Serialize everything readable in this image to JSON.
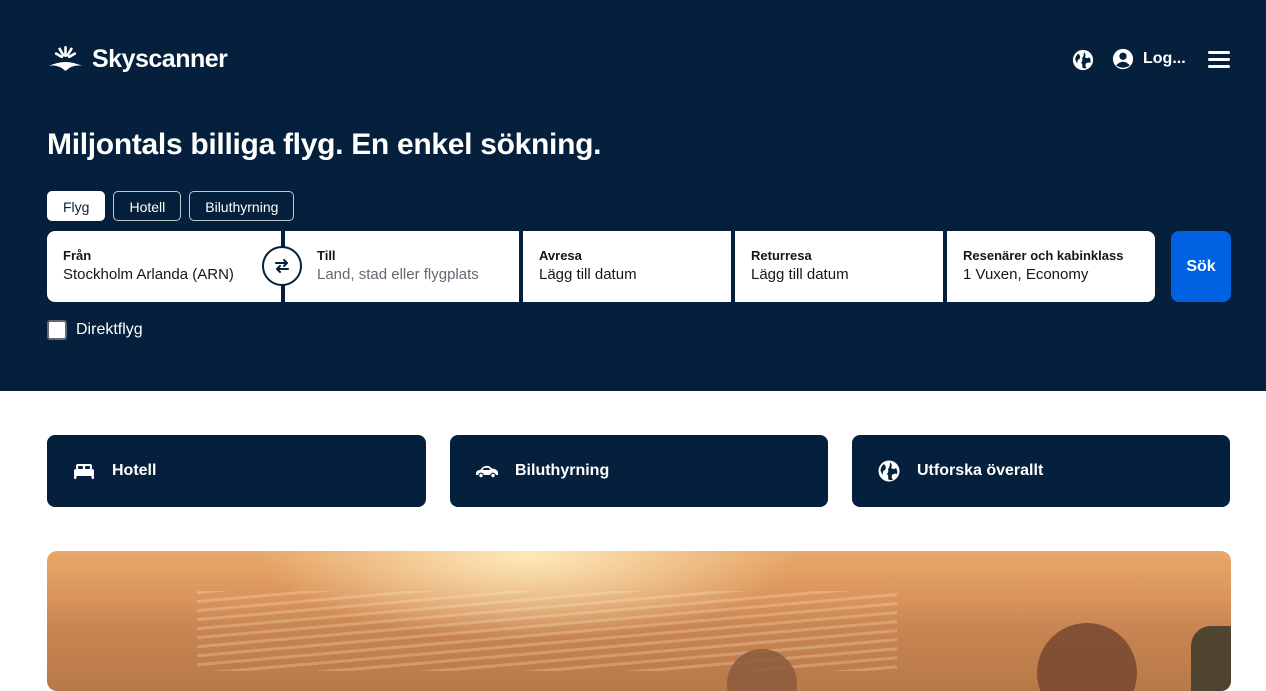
{
  "brand": {
    "name": "Skyscanner",
    "logo_icon": "sunrise-logo-icon"
  },
  "header": {
    "language_icon": "globe-icon",
    "login_icon": "user-circle-icon",
    "login_label": "Log...",
    "menu_icon": "hamburger-menu-icon"
  },
  "hero": {
    "headline": "Miljontals billiga flyg. En enkel sökning."
  },
  "tabs": [
    {
      "label": "Flyg",
      "active": true
    },
    {
      "label": "Hotell",
      "active": false
    },
    {
      "label": "Biluthyrning",
      "active": false
    }
  ],
  "search": {
    "from": {
      "label": "Från",
      "value": "Stockholm Arlanda (ARN)"
    },
    "to": {
      "label": "Till",
      "placeholder": "Land, stad eller flygplats"
    },
    "depart": {
      "label": "Avresa",
      "placeholder": "Lägg till datum"
    },
    "return": {
      "label": "Returresa",
      "placeholder": "Lägg till datum"
    },
    "travellers": {
      "label": "Resenärer och kabinklass",
      "value": "1 Vuxen, Economy"
    },
    "swap_icon": "swap-arrows-icon",
    "button_label": "Sök",
    "direct_label": "Direktflyg",
    "direct_checked": false
  },
  "cards": [
    {
      "label": "Hotell",
      "icon": "bed-icon"
    },
    {
      "label": "Biluthyrning",
      "icon": "car-icon"
    },
    {
      "label": "Utforska överallt",
      "icon": "globe-icon"
    }
  ],
  "colors": {
    "hero_bg": "#05203c",
    "primary_button": "#0062e3",
    "white": "#ffffff"
  }
}
